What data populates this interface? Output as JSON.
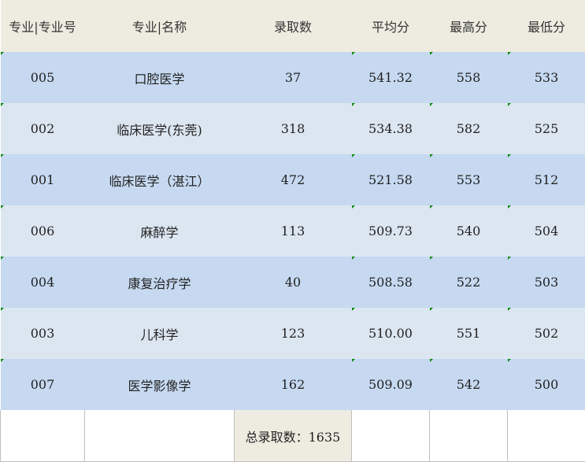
{
  "headers": [
    "专业|专业号",
    "专业|名称",
    "录取数",
    "平均分",
    "最高分",
    "最低分"
  ],
  "rows": [
    [
      "005",
      "口腔医学",
      "37",
      "541.32",
      "558",
      "533"
    ],
    [
      "002",
      "临床医学(东莞)",
      "318",
      "534.38",
      "582",
      "525"
    ],
    [
      "001",
      "临床医学（湛江）",
      "472",
      "521.58",
      "553",
      "512"
    ],
    [
      "006",
      "麻醉学",
      "113",
      "509.73",
      "540",
      "504"
    ],
    [
      "004",
      "康复治疗学",
      "40",
      "508.58",
      "522",
      "503"
    ],
    [
      "003",
      "儿科学",
      "123",
      "510.00",
      "551",
      "502"
    ],
    [
      "007",
      "医学影像学",
      "162",
      "509.09",
      "542",
      "500"
    ]
  ],
  "footer": {
    "total": "总录取数：1635"
  },
  "colors": {
    "header_bg": "#eeece1",
    "row_dark": "#c6d9f1",
    "row_light": "#dce6f1",
    "marker": "#0a8a0a"
  }
}
